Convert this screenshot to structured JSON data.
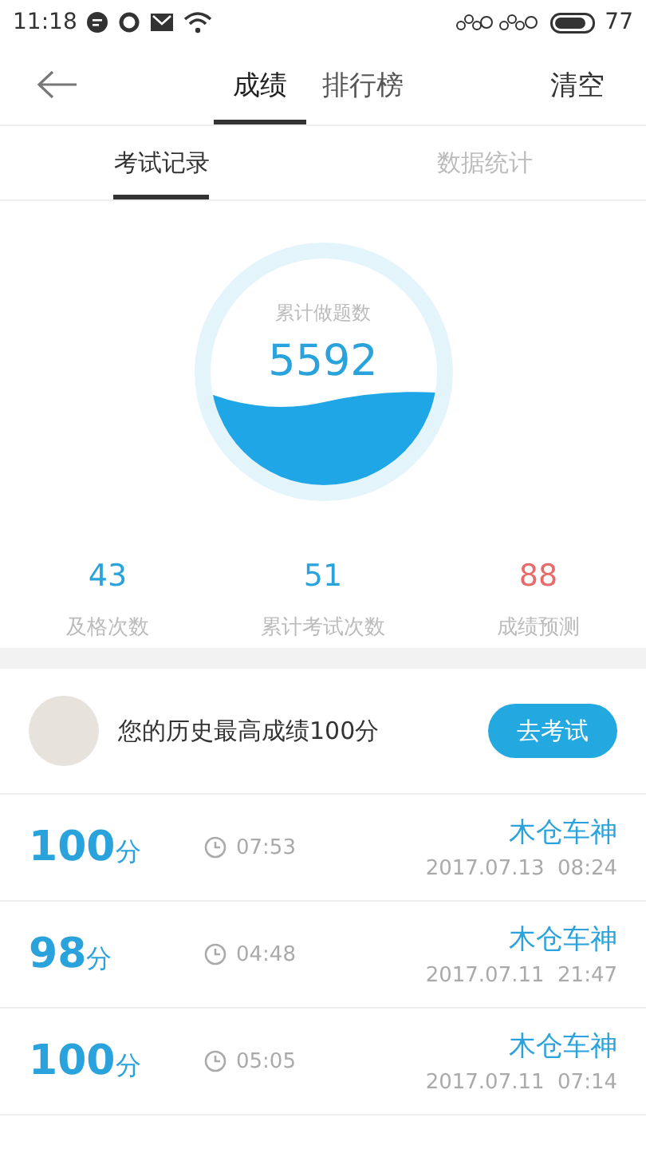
{
  "status_bar": {
    "time": "11:18",
    "battery": "77"
  },
  "nav": {
    "tabs": [
      {
        "label": "成绩",
        "selected": true
      },
      {
        "label": "排行榜",
        "selected": false
      }
    ],
    "action": "清空"
  },
  "sub_tabs": [
    {
      "label": "考试记录",
      "selected": true
    },
    {
      "label": "数据统计",
      "selected": false
    }
  ],
  "summary": {
    "label": "累计做题数",
    "value": "5592"
  },
  "stats": [
    {
      "value": "43",
      "label": "及格次数",
      "color": "#2aa3dc"
    },
    {
      "value": "51",
      "label": "累计考试次数",
      "color": "#2aa3dc"
    },
    {
      "value": "88",
      "label": "成绩预测",
      "color": "#e86a6a"
    }
  ],
  "best": {
    "text": "您的历史最高成绩100分",
    "button": "去考试"
  },
  "records": [
    {
      "score": "100",
      "unit": "分",
      "duration": "07:53",
      "name": "木仓车神",
      "datetime": "2017.07.13  08:24"
    },
    {
      "score": "98",
      "unit": "分",
      "duration": "04:48",
      "name": "木仓车神",
      "datetime": "2017.07.11  21:47"
    },
    {
      "score": "100",
      "unit": "分",
      "duration": "05:05",
      "name": "木仓车神",
      "datetime": "2017.07.11  07:14"
    }
  ]
}
